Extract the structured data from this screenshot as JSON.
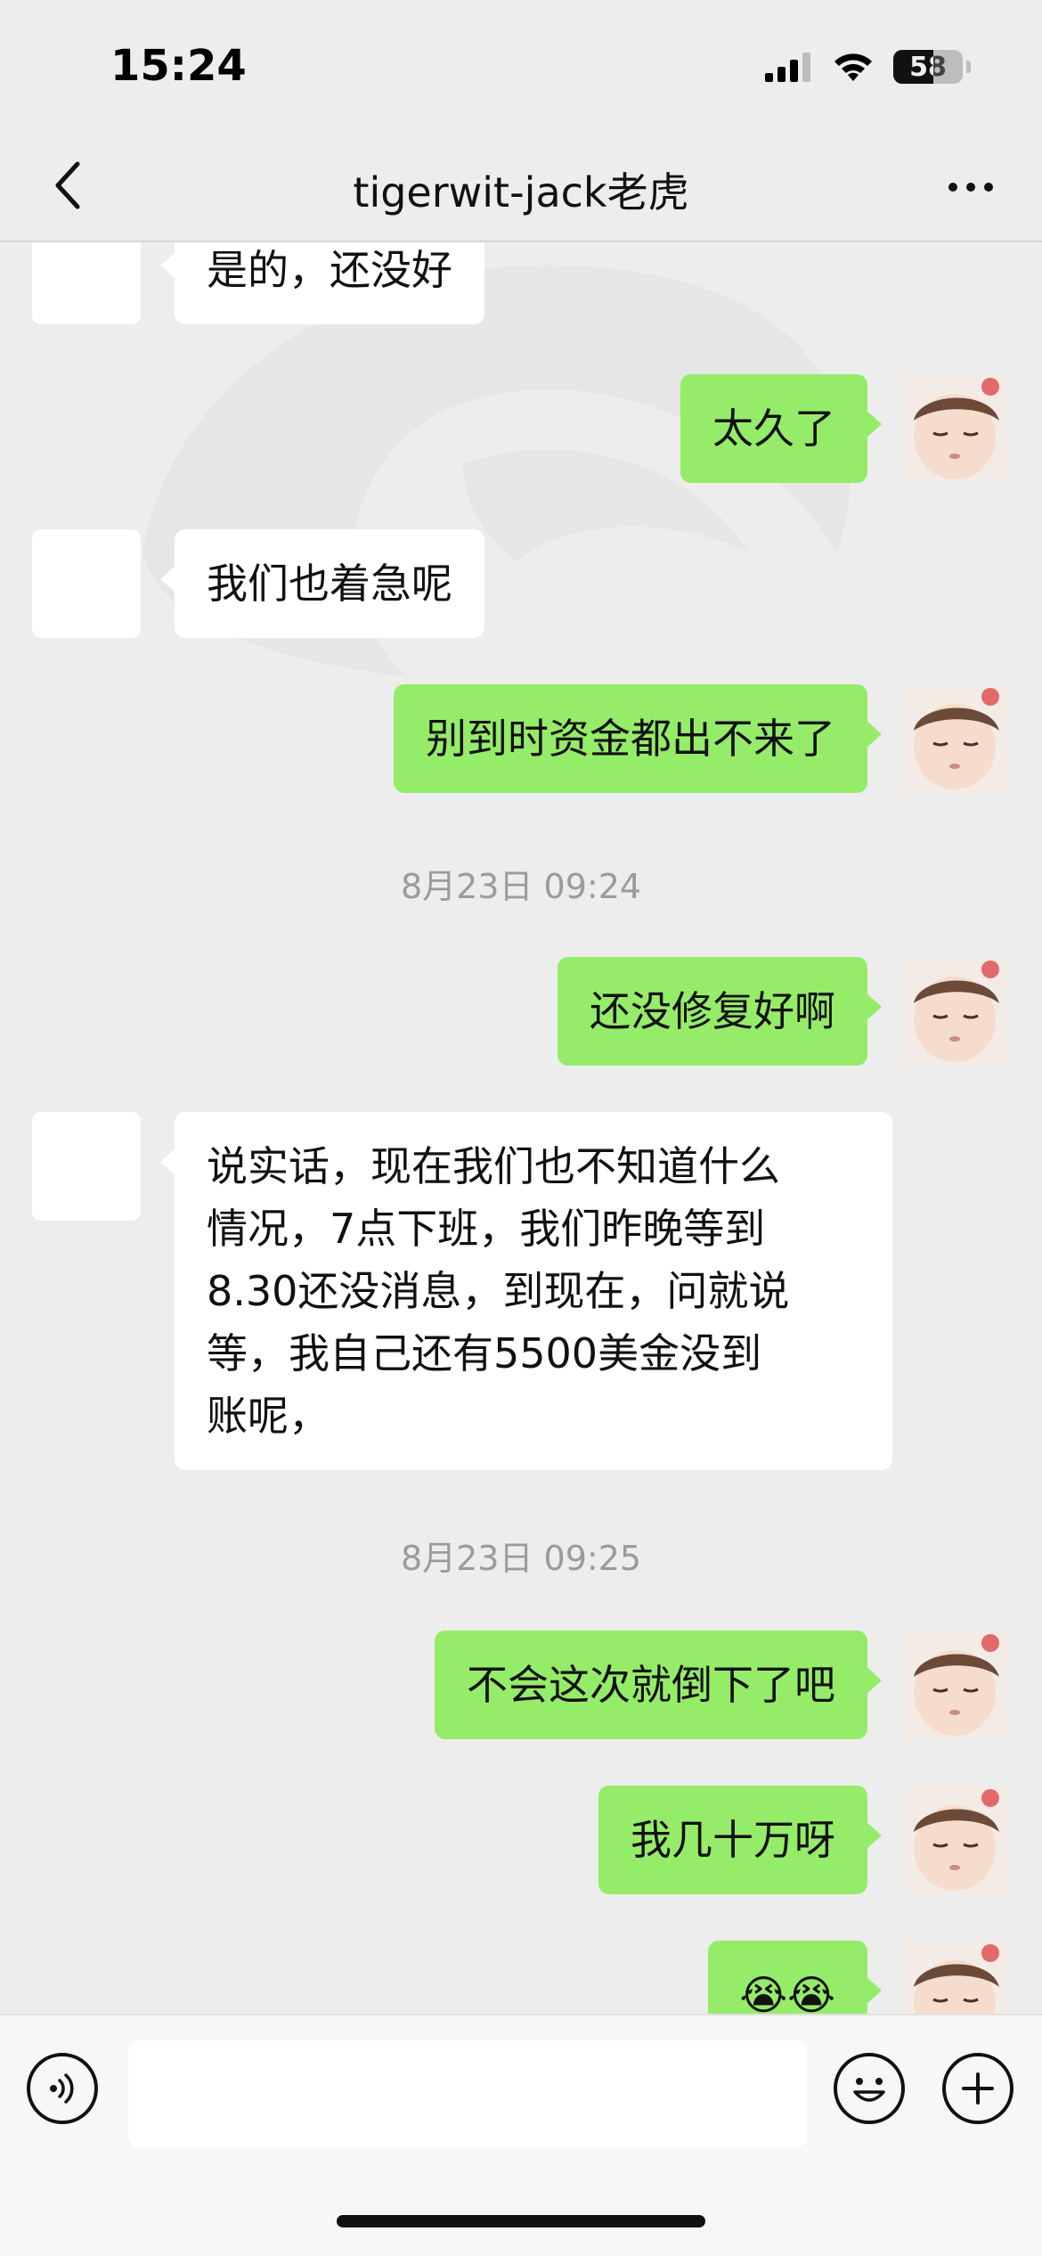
{
  "status_bar": {
    "time": "15:24",
    "battery": "58",
    "battery_level_percent": 58
  },
  "nav": {
    "title": "tigerwit-jack老虎"
  },
  "messages": [
    {
      "side": "left",
      "text": "是的，还没好"
    },
    {
      "side": "right",
      "text": "太久了"
    },
    {
      "side": "left",
      "text": "我们也着急呢"
    },
    {
      "side": "right",
      "text": "别到时资金都出不来了"
    },
    {
      "type": "timestamp",
      "text": "8月23日 09:24"
    },
    {
      "side": "right",
      "text": "还没修复好啊"
    },
    {
      "side": "left",
      "lines": [
        "说实话，现在我们也不知道什么",
        "情况，7点下班，我们昨晚等到",
        "8.30还没消息，到现在，问就说",
        "等，我自己还有5500美金没到",
        "账呢，"
      ]
    },
    {
      "type": "timestamp",
      "text": "8月23日 09:25"
    },
    {
      "side": "right",
      "text": "不会这次就倒下了吧"
    },
    {
      "side": "right",
      "text": "我几十万呀"
    },
    {
      "side": "right",
      "text": "😭😭"
    }
  ],
  "input_bar": {
    "placeholder": ""
  },
  "colors": {
    "background": "#ededed",
    "bubble_self": "#95ec69",
    "bubble_other": "#ffffff",
    "timestamp_text": "#9b9b9b"
  },
  "icons": {
    "back": "chevron-left-icon",
    "more": "more-dots-icon",
    "voice": "voice-icon",
    "emoji": "emoji-icon",
    "plus": "plus-icon"
  }
}
